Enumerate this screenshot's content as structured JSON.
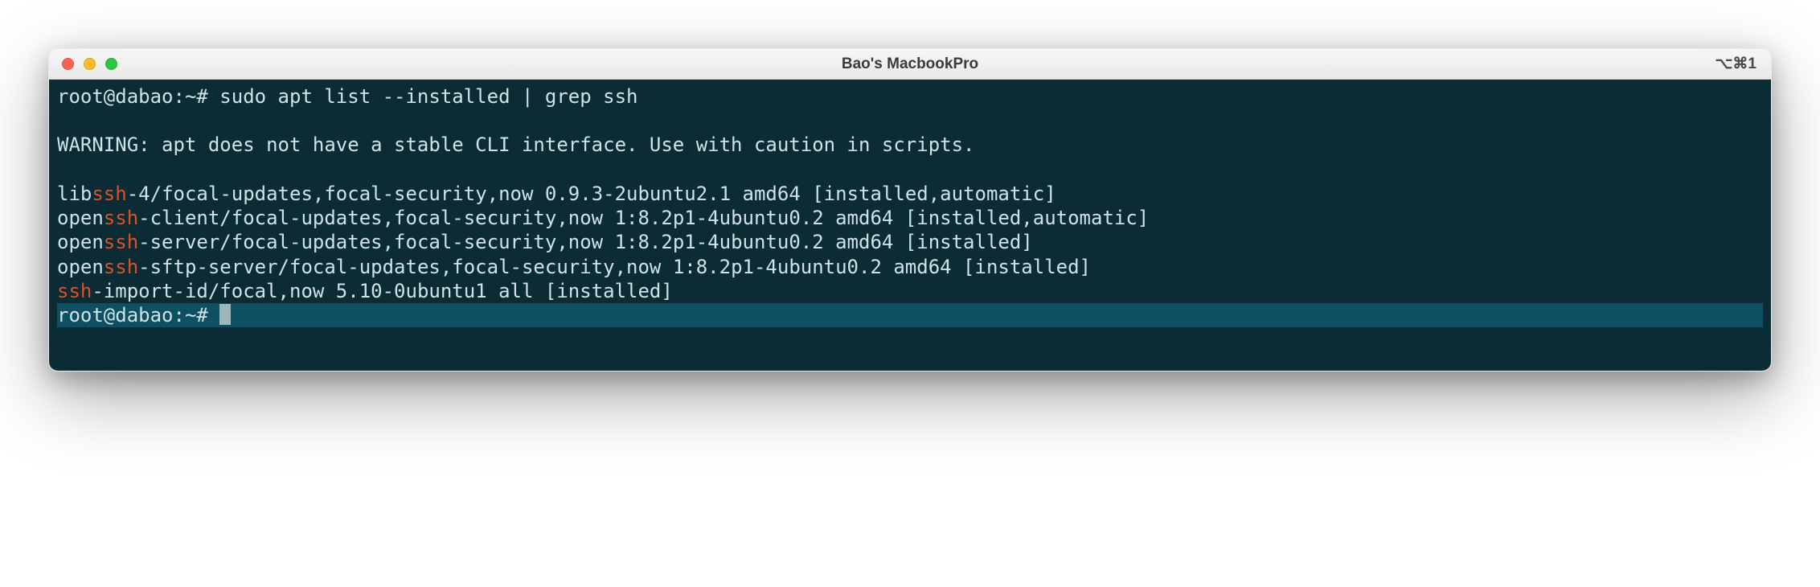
{
  "window": {
    "title": "Bao's MacbookPro",
    "shortcut": "⌥⌘1"
  },
  "colors": {
    "bg": "#0b2b35",
    "text": "#cfe3e6",
    "highlight": "#d9522b",
    "active_line": "#0e4f61"
  },
  "prompt": "root@dabao:~#",
  "command": "sudo apt list --installed | grep ssh",
  "warning": "WARNING: apt does not have a stable CLI interface. Use with caution in scripts.",
  "match_token": "ssh",
  "results": [
    {
      "pre": "lib",
      "match": "ssh",
      "post": "-4/focal-updates,focal-security,now 0.9.3-2ubuntu2.1 amd64 [installed,automatic]"
    },
    {
      "pre": "open",
      "match": "ssh",
      "post": "-client/focal-updates,focal-security,now 1:8.2p1-4ubuntu0.2 amd64 [installed,automatic]"
    },
    {
      "pre": "open",
      "match": "ssh",
      "post": "-server/focal-updates,focal-security,now 1:8.2p1-4ubuntu0.2 amd64 [installed]"
    },
    {
      "pre": "open",
      "match": "ssh",
      "post": "-sftp-server/focal-updates,focal-security,now 1:8.2p1-4ubuntu0.2 amd64 [installed]"
    },
    {
      "pre": "",
      "match": "ssh",
      "post": "-import-id/focal,now 5.10-0ubuntu1 all [installed]"
    }
  ]
}
